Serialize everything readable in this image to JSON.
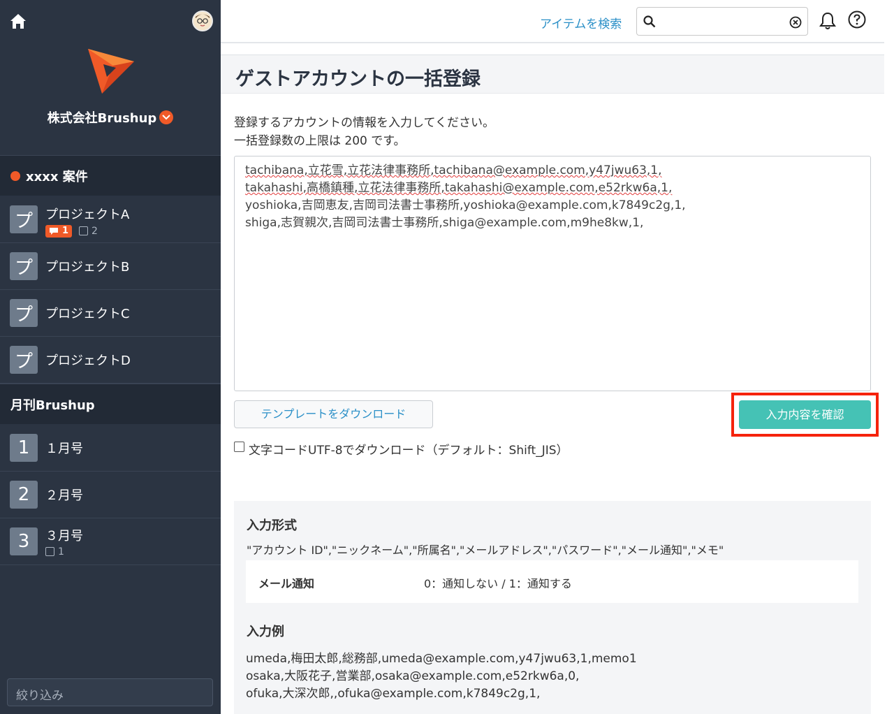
{
  "sidebar": {
    "org_name": "株式会社Brushup",
    "section1": {
      "label": "xxxx 案件"
    },
    "projects": [
      {
        "icon": "プ",
        "label": "プロジェクトA",
        "comments": "1",
        "tasks": "2"
      },
      {
        "icon": "プ",
        "label": "プロジェクトB"
      },
      {
        "icon": "プ",
        "label": "プロジェクトC"
      },
      {
        "icon": "プ",
        "label": "プロジェクトD"
      }
    ],
    "section2": {
      "label": "月刊Brushup"
    },
    "issues": [
      {
        "icon": "1",
        "label": "１月号"
      },
      {
        "icon": "2",
        "label": "２月号"
      },
      {
        "icon": "3",
        "label": "３月号",
        "tasks": "1"
      }
    ],
    "filter_placeholder": "絞り込み"
  },
  "topbar": {
    "search_link": "アイテムを検索",
    "search_value": ""
  },
  "main": {
    "title": "ゲストアカウントの一括登録",
    "desc1": "登録するアカウントの情報を入力してください。",
    "desc2": "一括登録数の上限は 200 です。",
    "input_lines": [
      "tachibana,立花雪,立花法律事務所,tachibana@example.com,y47jwu63,1,",
      "takahashi,高橋鎮種,立花法律事務所,takahashi@example.com,e52rkw6a,1,",
      "yoshioka,吉岡恵友,吉岡司法書士事務所,yoshioka@example.com,k7849c2g,1,",
      "shiga,志賀親次,吉岡司法書士事務所,shiga@example.com,m9he8kw,1,"
    ],
    "download_button": "テンプレートをダウンロード",
    "confirm_button": "入力内容を確認",
    "utf8_label": "文字コードUTF-8でダウンロード（デフォルト：Shift_JIS）",
    "utf8_checked": false
  },
  "format": {
    "title": "入力形式",
    "columns": "\"アカウント ID\",\"ニックネーム\",\"所属名\",\"メールアドレス\",\"パスワード\",\"メール通知\",\"メモ\"",
    "key": "メール通知",
    "value": "0：通知しない / 1：通知する",
    "example_title": "入力例",
    "examples": [
      "umeda,梅田太郎,総務部,umeda@example.com,y47jwu63,1,memo1",
      "osaka,大阪花子,営業部,osaka@example.com,e52rkw6a,0,",
      "ofuka,大深次郎,,ofuka@example.com,k7849c2g,1,"
    ]
  },
  "colors": {
    "accent": "#f05a28",
    "teal": "#45c2b5",
    "link": "#2a8fc7",
    "sidebar": "#2b3442",
    "highlight": "#f5230c"
  }
}
